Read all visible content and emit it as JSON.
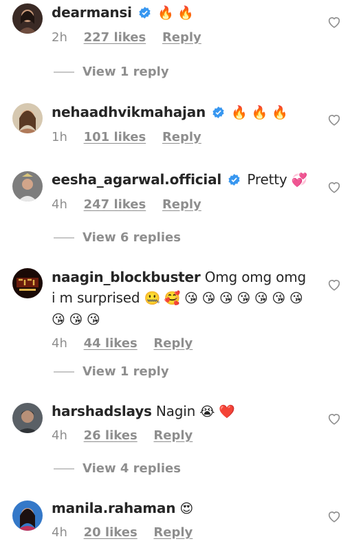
{
  "comments": [
    {
      "username": "dearmansi",
      "verified": true,
      "text": "",
      "emoji": "🔥 🔥",
      "time": "2h",
      "likes": "227 likes",
      "reply": "Reply",
      "view_replies": "View 1 reply"
    },
    {
      "username": "nehaadhvikmahajan",
      "verified": true,
      "text": "",
      "emoji": "🔥 🔥 🔥",
      "time": "1h",
      "likes": "101 likes",
      "reply": "Reply",
      "view_replies": ""
    },
    {
      "username": "eesha_agarwal.official",
      "verified": true,
      "text": "Pretty",
      "emoji": "💞",
      "time": "4h",
      "likes": "247 likes",
      "reply": "Reply",
      "view_replies": "View 6 replies"
    },
    {
      "username": "naagin_blockbuster",
      "verified": false,
      "text": "Omg omg omg i m surprised",
      "emoji": "🤐 🥰 😘 😘 😘 😘 😘 😘 😘 😘 😘 😘",
      "time": "4h",
      "likes": "44 likes",
      "reply": "Reply",
      "view_replies": "View 1 reply"
    },
    {
      "username": "harshadslays",
      "verified": false,
      "text": "Nagin",
      "emoji": "😭 ❤️",
      "time": "4h",
      "likes": "26 likes",
      "reply": "Reply",
      "view_replies": "View 4 replies"
    },
    {
      "username": "manila.rahaman",
      "verified": false,
      "text": "",
      "emoji": "😍",
      "time": "4h",
      "likes": "20 likes",
      "reply": "Reply",
      "view_replies": ""
    }
  ],
  "colors": {
    "verified": "#3897f0",
    "meta_gray": "#8e8e8e",
    "heart_stroke": "#8e8e8e"
  },
  "icons": {
    "like": "heart-outline-icon",
    "verified": "verified-badge-icon"
  }
}
